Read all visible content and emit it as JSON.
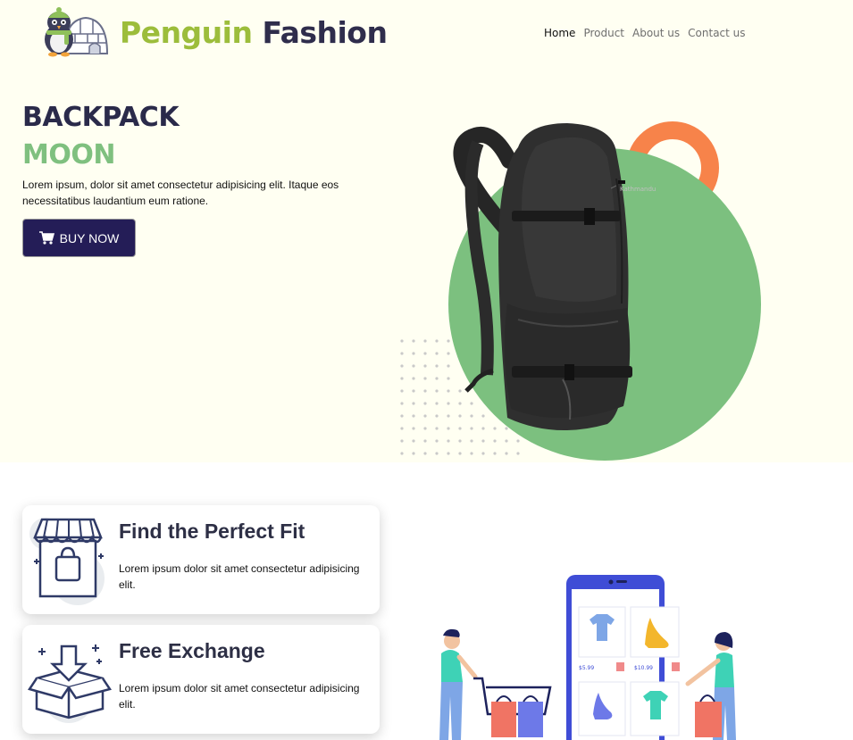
{
  "brand": {
    "name_part1": "Penguin",
    "name_part2": "Fashion",
    "logo": "penguin-igloo-logo"
  },
  "nav": {
    "items": [
      {
        "label": "Home",
        "active": true
      },
      {
        "label": "Product",
        "active": false
      },
      {
        "label": "About us",
        "active": false
      },
      {
        "label": "Contact us",
        "active": false
      }
    ]
  },
  "hero": {
    "title": "BACKPACK",
    "subtitle": "MOON",
    "description": "Lorem ipsum, dolor sit amet consectetur adipisicing elit. Itaque eos necessitatibus laudantium eum ratione.",
    "button_label": "BUY NOW",
    "button_icon": "shopping-cart-icon"
  },
  "features": [
    {
      "title": "Find the Perfect Fit",
      "text": "Lorem ipsum dolor sit amet consectetur adipisicing elit.",
      "icon": "storefront-icon"
    },
    {
      "title": "Free Exchange",
      "text": "Lorem ipsum dolor sit amet consectetur adipisicing elit.",
      "icon": "box-return-icon"
    }
  ],
  "illustration": {
    "price1": "$5.99",
    "price2": "$10.99"
  },
  "colors": {
    "hero_bg": "#fffff2",
    "brand_green": "#9cbd3b",
    "brand_navy": "#2f2d4c",
    "accent_green": "#7cc07f",
    "accent_orange": "#f7834a",
    "button_bg": "#241d57"
  }
}
